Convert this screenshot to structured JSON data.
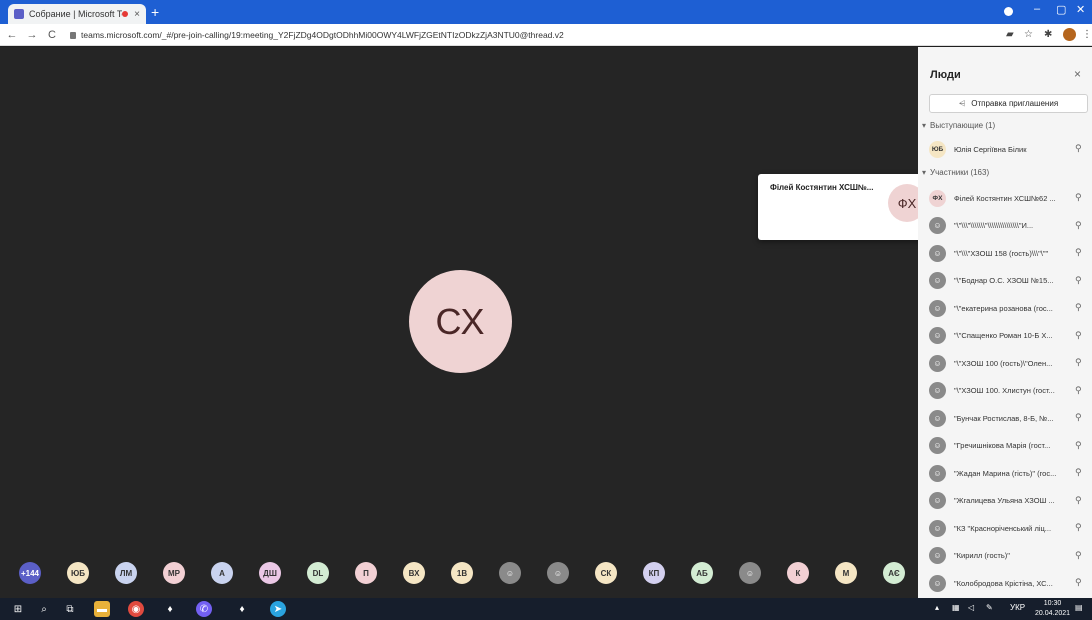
{
  "browser": {
    "tab_title": "Собрание | Microsoft Teams",
    "tab_close": "×",
    "new_tab": "+",
    "url": "teams.microsoft.com/_#/pre-join-calling/19:meeting_Y2FjZDg4ODgtODhhMi00OWY4LWFjZGEtNTIzODkzZjA3NTU0@thread.v2",
    "back": "←",
    "forward": "→",
    "reload": "C",
    "minimize": "–",
    "maximize": "▢",
    "close": "✕"
  },
  "stage": {
    "main_initials": "СХ"
  },
  "hover_card": {
    "name": "Філей Костянтин ХСШ№...",
    "initials": "ФХ"
  },
  "strip": [
    {
      "label": "+144",
      "color": "#5b5fc7",
      "text_color": "#ffffff"
    },
    {
      "label": "ЮБ",
      "color": "#f5e6c4"
    },
    {
      "label": "ЛМ",
      "color": "#c9d3ef"
    },
    {
      "label": "МР",
      "color": "#f2d0d4"
    },
    {
      "label": "А",
      "color": "#c9d3ef"
    },
    {
      "label": "ДШ",
      "color": "#ebc8e6"
    },
    {
      "label": "DL",
      "color": "#d3ecd3"
    },
    {
      "label": "П",
      "color": "#f2d0d4"
    },
    {
      "label": "ВХ",
      "color": "#f5e6c4"
    },
    {
      "label": "1В",
      "color": "#f5e6c4"
    },
    {
      "label": "",
      "color": "#8a8a8a",
      "icon": "guest"
    },
    {
      "label": "",
      "color": "#8a8a8a",
      "icon": "guest"
    },
    {
      "label": "СК",
      "color": "#f5e6c4"
    },
    {
      "label": "КП",
      "color": "#d3d0ef"
    },
    {
      "label": "АБ",
      "color": "#d3ecd3"
    },
    {
      "label": "",
      "color": "#8a8a8a",
      "icon": "guest"
    },
    {
      "label": "К",
      "color": "#f2d0d4"
    },
    {
      "label": "М",
      "color": "#f5e6c4"
    },
    {
      "label": "АЄ",
      "color": "#d3ecd3"
    }
  ],
  "panel": {
    "title": "Люди",
    "close": "×",
    "invite_label": "Отправка приглашения",
    "presenters_header": "Выступающие (1)",
    "participants_header": "Участники (163)",
    "presenters": [
      {
        "initials": "ЮБ",
        "name": "Юлія Сергіївна Білик",
        "color": "#f5e6c4"
      }
    ],
    "participants": [
      {
        "initials": "ФХ",
        "name": "Філей Костянтин ХСШ№62 ...",
        "color": "#efd3d3"
      },
      {
        "initials": "",
        "name": "\"\\\"\\\\\\\"\\\\\\\\\\\\\\\"\\\\\\\\\\\\\\\\\\\\\\\\\\\\\\\"И...",
        "color": "#8a8a8a"
      },
      {
        "initials": "",
        "name": "\"\\\"\\\\\\\"ХЗОШ 158 (гость)\\\\\\\"\\\"\"",
        "color": "#8a8a8a"
      },
      {
        "initials": "",
        "name": "\"\\\"Боднар О.С. ХЗОШ №15...",
        "color": "#8a8a8a"
      },
      {
        "initials": "",
        "name": "\"\\\"екатерина розанова (гос...",
        "color": "#8a8a8a"
      },
      {
        "initials": "",
        "name": "\"\\\"Спащенко Роман 10-Б Х...",
        "color": "#8a8a8a"
      },
      {
        "initials": "",
        "name": "\"\\\"ХЗОШ 100 (гость)\\\"Олен...",
        "color": "#8a8a8a"
      },
      {
        "initials": "",
        "name": "\"\\\"ХЗОШ 100. Хлистун (гост...",
        "color": "#8a8a8a"
      },
      {
        "initials": "",
        "name": "\"Бунчак Ростислав, 8-Б, №...",
        "color": "#8a8a8a"
      },
      {
        "initials": "",
        "name": "\"Гречишнікова Марія (гост...",
        "color": "#8a8a8a"
      },
      {
        "initials": "",
        "name": "\"Жадан Марина (гість)\" (гос...",
        "color": "#8a8a8a"
      },
      {
        "initials": "",
        "name": "\"Жгалицева Ульяна ХЗОШ ...",
        "color": "#8a8a8a"
      },
      {
        "initials": "",
        "name": "\"КЗ \"Красноріченський ліц...",
        "color": "#8a8a8a"
      },
      {
        "initials": "",
        "name": "\"Кирилл (гость)\"",
        "color": "#8a8a8a"
      },
      {
        "initials": "",
        "name": "\"Колобродова Крістіна, ХС...",
        "color": "#8a8a8a"
      }
    ]
  },
  "taskbar": {
    "lang": "УКР",
    "time": "10:30",
    "date": "20.04.2021"
  }
}
